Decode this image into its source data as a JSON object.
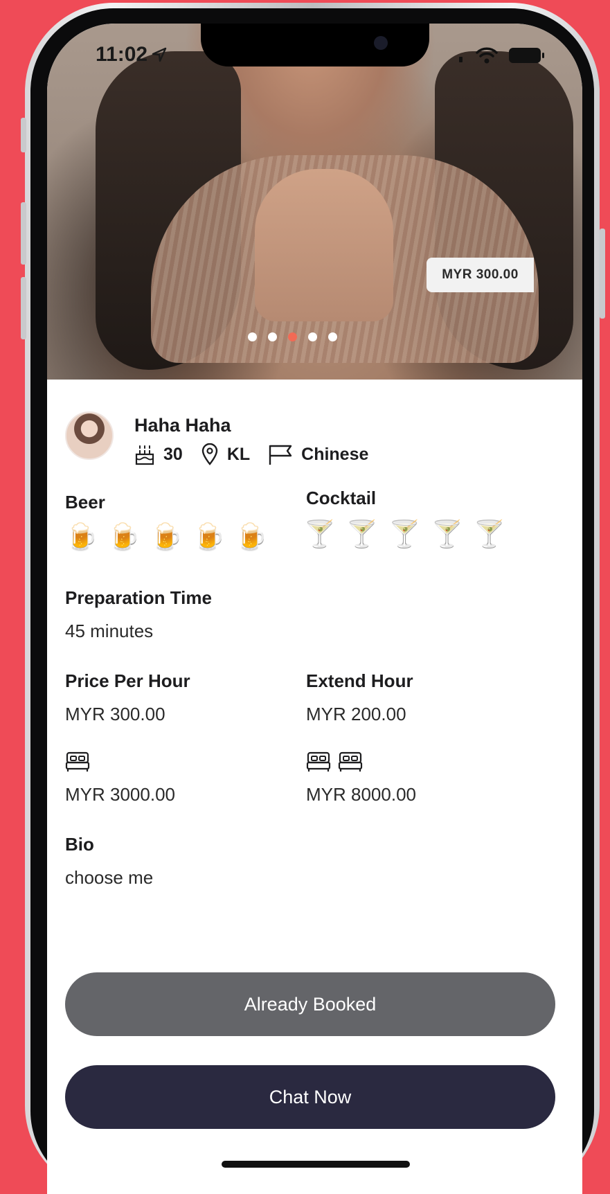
{
  "status_bar": {
    "time": "11:02"
  },
  "photo": {
    "price": "MYR 300.00",
    "carousel_count": 5,
    "carousel_active_index": 2
  },
  "profile": {
    "name": "Haha Haha",
    "age": "30",
    "location": "KL",
    "ethnicity": "Chinese"
  },
  "drinks": {
    "beer": {
      "label": "Beer",
      "level": 5,
      "max": 5,
      "emoji": "🍺"
    },
    "cocktail": {
      "label": "Cocktail",
      "level": 5,
      "max": 5,
      "emoji": "🍸"
    }
  },
  "preparation": {
    "label": "Preparation Time",
    "value": "45 minutes"
  },
  "pricing": {
    "price_per_hour": {
      "label": "Price Per Hour",
      "value": "MYR 300.00"
    },
    "extend_hour": {
      "label": "Extend Hour",
      "value": "MYR 200.00"
    },
    "overnight_single": {
      "value": "MYR 3000.00",
      "bed_count": 1
    },
    "overnight_double": {
      "value": "MYR 8000.00",
      "bed_count": 2
    }
  },
  "bio": {
    "label": "Bio",
    "value": "choose me"
  },
  "actions": {
    "booked_label": "Already Booked",
    "chat_label": "Chat Now"
  },
  "colors": {
    "background": "#ef4b57",
    "active_dot": "#f26a55",
    "booked_button": "#646569",
    "chat_button": "#2a2940"
  }
}
